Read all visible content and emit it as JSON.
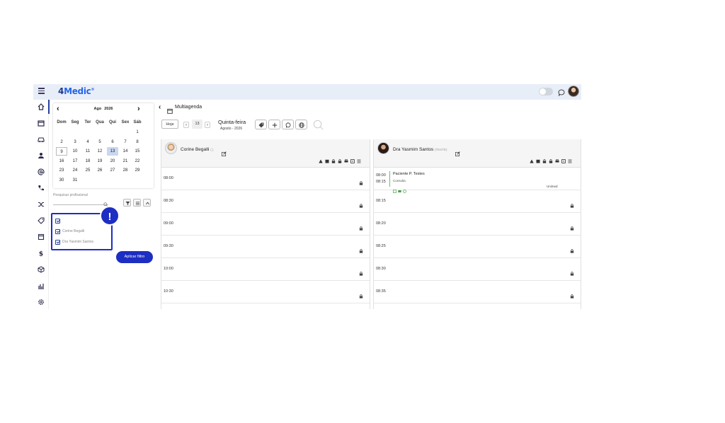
{
  "app": {
    "logo_number": "4",
    "logo_text": "Medic",
    "logo_mark": "®"
  },
  "rail": {
    "icons": [
      "home-icon",
      "calendar-icon",
      "car-icon",
      "user-icon",
      "at-sign-icon",
      "phone-icon",
      "shuffle-icon",
      "tag-icon",
      "document-icon",
      "dollar-icon",
      "box-icon",
      "chart-icon",
      "gear-icon"
    ]
  },
  "calendar": {
    "month": "Ago",
    "year": "2026",
    "weekdays": [
      "Dom",
      "Seg",
      "Ter",
      "Qua",
      "Qui",
      "Sex",
      "Sáb"
    ],
    "weeks": [
      [
        "",
        "",
        "",
        "",
        "",
        "",
        "1"
      ],
      [
        "2",
        "3",
        "4",
        "5",
        "6",
        "7",
        "8"
      ],
      [
        "9",
        "10",
        "11",
        "12",
        "13",
        "14",
        "15"
      ],
      [
        "16",
        "17",
        "18",
        "19",
        "20",
        "21",
        "22"
      ],
      [
        "23",
        "24",
        "25",
        "26",
        "27",
        "28",
        "29"
      ],
      [
        "30",
        "31",
        "",
        "",
        "",
        "",
        ""
      ]
    ],
    "selected_day": "13",
    "outlined_day": "9"
  },
  "professional_filter": {
    "search_placeholder": "Pesquisar profissional",
    "items": [
      {
        "label": "",
        "checked": true
      },
      {
        "label": "Corine Begalli",
        "checked": true
      },
      {
        "label": "Dra Yasmim Santos",
        "checked": true
      }
    ],
    "alert_badge": "!",
    "apply_label": "Aplicar filtro"
  },
  "header": {
    "back": "‹",
    "title": "Multiagenda",
    "today_label": "Hoje",
    "prev": "‹",
    "day": "13",
    "next": "›",
    "weekday": "Quinta-feira",
    "month_year": "Agosto - 2026"
  },
  "columns": [
    {
      "doctor": "Corine Begalli",
      "doctor_suffix": "(.)",
      "slots": [
        "08:00",
        "08:30",
        "09:00",
        "09:30",
        "10:00",
        "10:30"
      ]
    },
    {
      "doctor": "Dra Yasmim Santos",
      "doctor_suffix": "(TESTE)",
      "appointment": {
        "start": "08:00",
        "end": "08:15",
        "patient": "Paciente P. Testes",
        "type": "Consulta",
        "insurance": "Unimed"
      },
      "slots": [
        "08:15",
        "08:20",
        "08:25",
        "08:30",
        "08:35"
      ]
    }
  ],
  "colors": {
    "accent": "#1d2ec2",
    "topbar": "#e8eef8",
    "appointment_bar": "#6cbf6c"
  }
}
